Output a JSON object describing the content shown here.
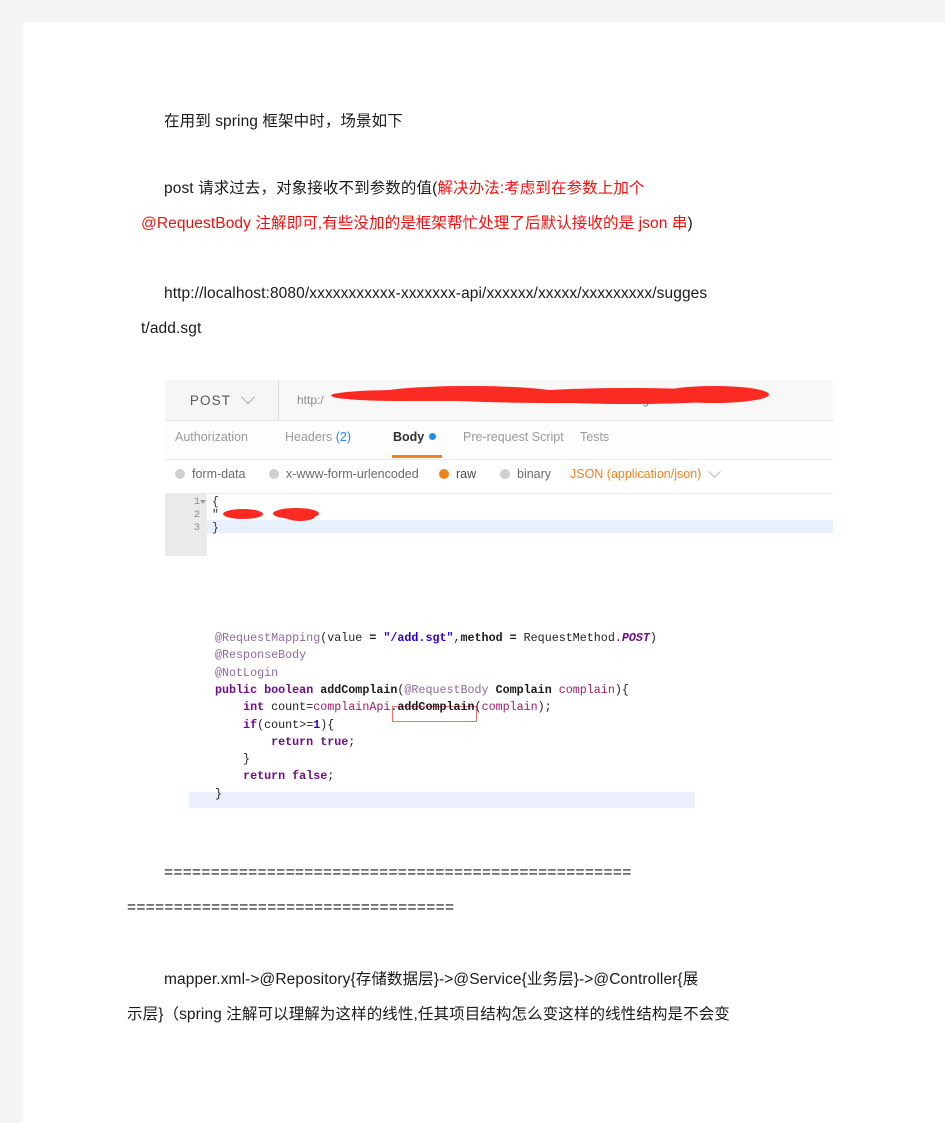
{
  "document": {
    "paragraphs": [
      {
        "id": "p1",
        "text": "在用到 spring 框架中时，场景如下"
      },
      {
        "id": "p2_line1_black",
        "text": "post 请求过去，对象接收不到参数的值("
      },
      {
        "id": "p2_line1_red",
        "text": "解决办法:考虑到在参数上加个"
      },
      {
        "id": "p2_line2_red",
        "text": "@RequestBody 注解即可,有些没加的是框架帮忙处理了后默认接收的是 json 串"
      },
      {
        "id": "p2_line2_tail",
        "text": ")"
      },
      {
        "id": "p3_line1",
        "text": "http://localhost:8080/xxxxxxxxxxx-xxxxxxx-api/xxxxxx/xxxxx/xxxxxxxxx/sugges"
      },
      {
        "id": "p3_line2",
        "text": "t/add.sgt"
      },
      {
        "id": "sep_line1",
        "text": "=================================================="
      },
      {
        "id": "sep_line2",
        "text": "==================================="
      },
      {
        "id": "p4_line1",
        "text": "mapper.xml->@Repository{存储数据层}->@Service{业务层}->@Controller{展"
      },
      {
        "id": "p4_line2",
        "text": "示层}（spring 注解可以理解为这样的线性,任其项目结构怎么变这样的线性结构是不会变"
      }
    ]
  },
  "postman": {
    "method": {
      "label": "POST",
      "caret_icon": "chevron-down-icon"
    },
    "url": {
      "prefix": "http:/",
      "suffix": "/add.sgt",
      "redacted": true
    },
    "tabs": [
      {
        "id": "authorization",
        "label": "Authorization",
        "active": false,
        "count": ""
      },
      {
        "id": "headers",
        "label": "Headers",
        "active": false,
        "count": "(2)"
      },
      {
        "id": "body",
        "label": "Body",
        "active": true,
        "count": "",
        "has_dot": true
      },
      {
        "id": "pre-request",
        "label": "Pre-request Script",
        "active": false,
        "count": ""
      },
      {
        "id": "tests",
        "label": "Tests",
        "active": false,
        "count": ""
      }
    ],
    "body_types": [
      {
        "id": "form-data",
        "label": "form-data",
        "selected": false
      },
      {
        "id": "x-www-form-urlencoded",
        "label": "x-www-form-urlencoded",
        "selected": false
      },
      {
        "id": "raw",
        "label": "raw",
        "selected": true
      },
      {
        "id": "binary",
        "label": "binary",
        "selected": false
      }
    ],
    "content_type": {
      "label": "JSON (application/json)",
      "caret_icon": "chevron-down-icon"
    },
    "editor": {
      "lines": [
        {
          "num": "1",
          "fold": true,
          "text": "{",
          "active": false
        },
        {
          "num": "2",
          "fold": false,
          "text": "\"",
          "active": false
        },
        {
          "num": "3",
          "fold": false,
          "text": "}",
          "active": true
        }
      ]
    },
    "colors": {
      "accent_orange": "#f0821e",
      "accent_blue": "#1b8ef2",
      "redaction": "#fb2a23"
    }
  },
  "code": {
    "highlight_box": {
      "label": "@RequestBody",
      "border_color": "#e8736a"
    },
    "lines": [
      {
        "id": "l1",
        "tokens": [
          {
            "t": "@RequestMapping",
            "c": "ann"
          },
          {
            "t": "(",
            "c": "plain"
          },
          {
            "t": "value",
            "c": "plain"
          },
          {
            "t": " = ",
            "c": "mth"
          },
          {
            "t": "\"/add.sgt\"",
            "c": "str"
          },
          {
            "t": ",",
            "c": "plain"
          },
          {
            "t": "method",
            "c": "mth"
          },
          {
            "t": " = ",
            "c": "mth"
          },
          {
            "t": "RequestMethod.",
            "c": "plain"
          },
          {
            "t": "POST",
            "c": "cst"
          },
          {
            "t": ")",
            "c": "plain"
          }
        ]
      },
      {
        "id": "l2",
        "tokens": [
          {
            "t": "@ResponseBody",
            "c": "ann"
          }
        ]
      },
      {
        "id": "l3",
        "tokens": [
          {
            "t": "@NotLogin",
            "c": "ann"
          }
        ]
      },
      {
        "id": "l4",
        "tokens": [
          {
            "t": "public",
            "c": "kw"
          },
          {
            "t": " ",
            "c": "plain"
          },
          {
            "t": "boolean",
            "c": "kw"
          },
          {
            "t": " ",
            "c": "plain"
          },
          {
            "t": "addComplain",
            "c": "mth"
          },
          {
            "t": "(",
            "c": "plain"
          },
          {
            "t": "@RequestBody",
            "c": "ann"
          },
          {
            "t": " ",
            "c": "plain"
          },
          {
            "t": "Complain",
            "c": "mth"
          },
          {
            "t": " ",
            "c": "plain"
          },
          {
            "t": "complain",
            "c": "prm"
          },
          {
            "t": "){",
            "c": "plain"
          }
        ]
      },
      {
        "id": "l5",
        "tokens": [
          {
            "t": "    ",
            "c": "plain"
          },
          {
            "t": "int",
            "c": "kw"
          },
          {
            "t": " ",
            "c": "plain"
          },
          {
            "t": "count",
            "c": "plain"
          },
          {
            "t": "=",
            "c": "plain"
          },
          {
            "t": "complainApi",
            "c": "fld"
          },
          {
            "t": ".",
            "c": "plain"
          },
          {
            "t": "addComplain",
            "c": "mth"
          },
          {
            "t": "(",
            "c": "plain"
          },
          {
            "t": "complain",
            "c": "prm"
          },
          {
            "t": ");",
            "c": "plain"
          }
        ]
      },
      {
        "id": "l6",
        "tokens": [
          {
            "t": "    ",
            "c": "plain"
          },
          {
            "t": "if",
            "c": "kw"
          },
          {
            "t": "(",
            "c": "plain"
          },
          {
            "t": "count",
            "c": "plain"
          },
          {
            "t": ">=",
            "c": "plain"
          },
          {
            "t": "1",
            "c": "str"
          },
          {
            "t": "){",
            "c": "plain"
          }
        ]
      },
      {
        "id": "l7",
        "tokens": [
          {
            "t": "        ",
            "c": "plain"
          },
          {
            "t": "return",
            "c": "kw"
          },
          {
            "t": " ",
            "c": "plain"
          },
          {
            "t": "true",
            "c": "kw"
          },
          {
            "t": ";",
            "c": "plain"
          }
        ]
      },
      {
        "id": "l8",
        "tokens": [
          {
            "t": "    }",
            "c": "plain"
          }
        ]
      },
      {
        "id": "l9",
        "tokens": [
          {
            "t": "    ",
            "c": "plain"
          },
          {
            "t": "return",
            "c": "kw"
          },
          {
            "t": " ",
            "c": "plain"
          },
          {
            "t": "false",
            "c": "kw"
          },
          {
            "t": ";",
            "c": "plain"
          }
        ]
      },
      {
        "id": "l10",
        "tokens": [
          {
            "t": "}",
            "c": "plain"
          }
        ]
      }
    ]
  }
}
